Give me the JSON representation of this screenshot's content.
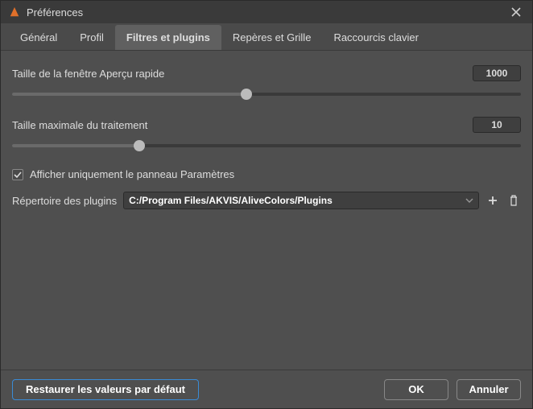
{
  "title": "Préférences",
  "tabs": [
    {
      "label": "Général",
      "active": false
    },
    {
      "label": "Profil",
      "active": false
    },
    {
      "label": "Filtres et plugins",
      "active": true
    },
    {
      "label": "Repères et Grille",
      "active": false
    },
    {
      "label": "Raccourcis clavier",
      "active": false
    }
  ],
  "preview_size": {
    "label": "Taille de la fenêtre Aperçu rapide",
    "value": "1000",
    "fill_pct": 46
  },
  "max_processing": {
    "label": "Taille maximale du traitement",
    "value": "10",
    "fill_pct": 25
  },
  "checkbox": {
    "label": "Afficher uniquement le panneau Paramètres",
    "checked": true
  },
  "plugins": {
    "label": "Répertoire des plugins",
    "path": "C:/Program Files/AKVIS/AliveColors/Plugins"
  },
  "footer": {
    "restore": "Restaurer les valeurs par défaut",
    "ok": "OK",
    "cancel": "Annuler"
  }
}
